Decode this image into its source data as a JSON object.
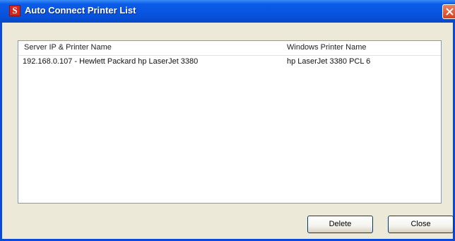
{
  "window": {
    "title": "Auto Connect Printer List",
    "app_icon_glyph": "S",
    "colors": {
      "titlebar": "#0854e0",
      "frame": "#0a4ad8",
      "body": "#ece9d8",
      "close": "#d8401c"
    }
  },
  "list": {
    "columns": [
      "Server IP & Printer Name",
      "Windows Printer Name"
    ],
    "rows": [
      [
        "192.168.0.107 - Hewlett Packard hp LaserJet 3380",
        "hp LaserJet 3380 PCL 6"
      ]
    ]
  },
  "buttons": {
    "delete_label": "Delete",
    "close_label": "Close"
  },
  "icons": {
    "close": "close-x-icon",
    "app": "app-logo-icon"
  }
}
